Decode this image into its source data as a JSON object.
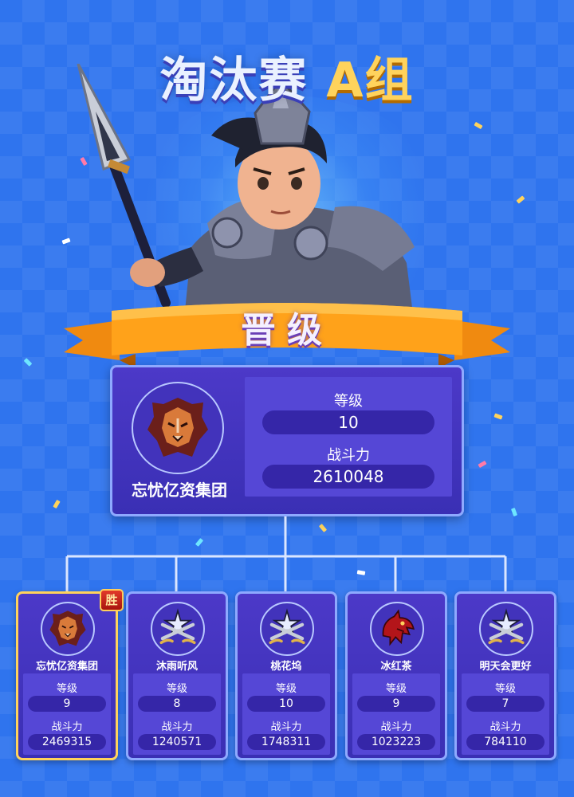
{
  "title": {
    "part1": "淘汰赛",
    "part2": "A组"
  },
  "banner": {
    "label": "晋级"
  },
  "advanced": {
    "name": "忘忧亿资集团",
    "level_label": "等级",
    "level": "10",
    "power_label": "战斗力",
    "power": "2610048",
    "emblem": "lion-emblem-icon"
  },
  "bracket": [
    {
      "name": "忘忧亿资集团",
      "level_label": "等级",
      "level": "9",
      "power_label": "战斗力",
      "power": "2469315",
      "emblem": "lion-emblem-icon",
      "badge": "胜"
    },
    {
      "name": "沐雨听风",
      "level_label": "等级",
      "level": "8",
      "power_label": "战斗力",
      "power": "1240571",
      "emblem": "crossed-swords-emblem-icon"
    },
    {
      "name": "桃花坞",
      "level_label": "等级",
      "level": "10",
      "power_label": "战斗力",
      "power": "1748311",
      "emblem": "crossed-swords-emblem-icon"
    },
    {
      "name": "冰红茶",
      "level_label": "等级",
      "level": "9",
      "power_label": "战斗力",
      "power": "1023223",
      "emblem": "dragon-emblem-icon"
    },
    {
      "name": "明天会更好",
      "level_label": "等级",
      "level": "7",
      "power_label": "战斗力",
      "power": "784110",
      "emblem": "crossed-swords-emblem-icon"
    }
  ],
  "colors": {
    "background": "#2f74ee",
    "card": "#3a2fb4",
    "card_border": "#8ea9ff",
    "ribbon": "#ffa21a",
    "title_accent": "#ffd35c",
    "win_badge": "#c8221a"
  }
}
